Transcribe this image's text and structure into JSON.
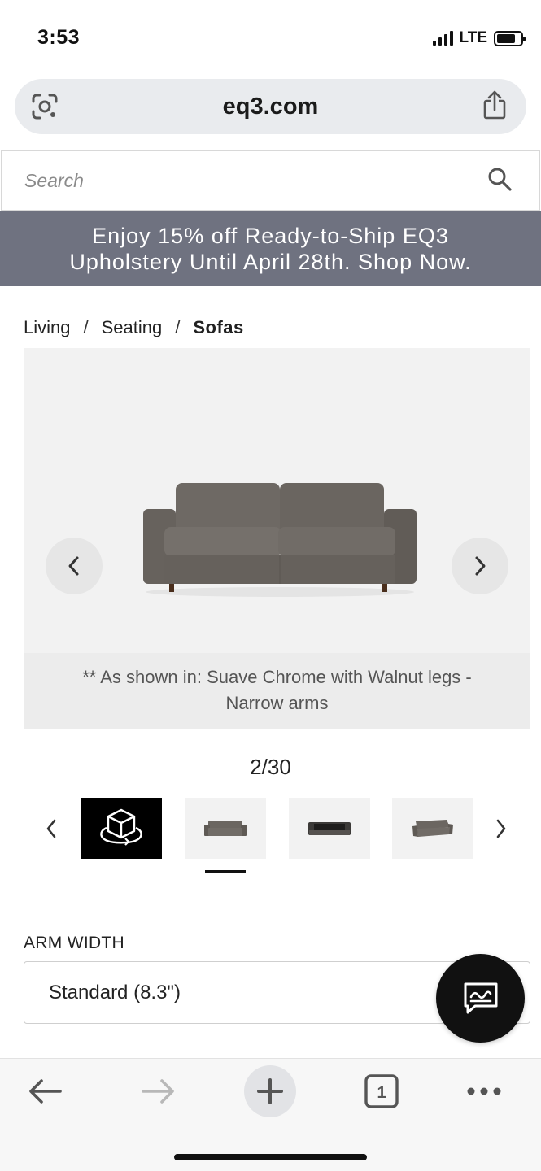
{
  "status_bar": {
    "time": "3:53",
    "network": "LTE"
  },
  "browser": {
    "url": "eq3.com",
    "icons": {
      "left": "lens-icon",
      "right": "share-icon"
    }
  },
  "search": {
    "placeholder": "Search",
    "value": ""
  },
  "promo": {
    "line1": "Enjoy 15% off Ready-to-Ship EQ3",
    "line2": "Upholstery Until April 28th. Shop Now.",
    "background": "#6f7280"
  },
  "breadcrumb": {
    "items": [
      "Living",
      "Seating",
      "Sofas"
    ],
    "separator": "/"
  },
  "gallery": {
    "caption_line1": "** As shown in: Suave Chrome with Walnut legs -",
    "caption_line2": "Narrow arms",
    "counter": "2/30",
    "sofa_color": "#6b6661"
  },
  "options": {
    "arm_width_label": "ARM WIDTH",
    "arm_width_value": "Standard (8.3\")"
  },
  "toolbar": {
    "tabs_count": "1"
  }
}
